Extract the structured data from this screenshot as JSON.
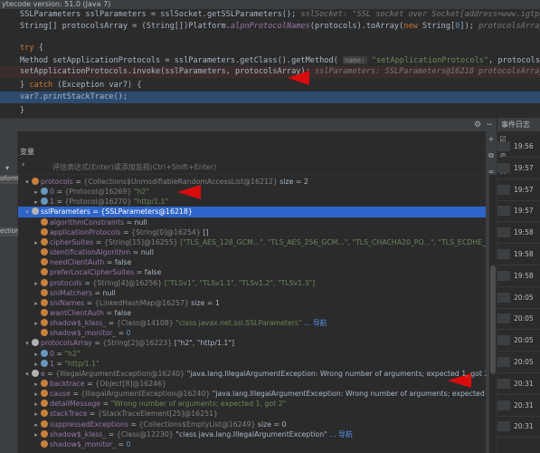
{
  "banner": {
    "text": "ytecode version: 51.0 (Java 7)"
  },
  "editor": {
    "lines": [
      {
        "parts": [
          [
            "",
            "SSLParameters sslParameters = sslSocket.getSSLParameters();"
          ],
          [
            "hint",
            "  sslSocket: \"SSL socket over Socket[address=www.igtpgtng.com/52.77.193.19,port=443,loc\""
          ]
        ]
      },
      {
        "parts": [
          [
            "",
            "String[] protocolsArray = (String[])Platform."
          ],
          [
            "fn",
            "alpnProtocolNames"
          ],
          [
            "",
            "(protocols).toArray("
          ],
          [
            "kw",
            "new "
          ],
          [
            "",
            "String["
          ],
          [
            "num",
            "0"
          ],
          [
            "",
            "]);"
          ],
          [
            "hint",
            "  protocolsArray: [\"h2\", \"http/1.1\"]"
          ]
        ]
      },
      {
        "parts": [
          [
            "",
            ""
          ]
        ]
      },
      {
        "parts": [
          [
            "kw",
            "try "
          ],
          [
            "",
            "{"
          ]
        ]
      },
      {
        "parts": [
          [
            "",
            "    Method setApplicationProtocols = sslParameters.getClass().getMethod( "
          ],
          [
            "box",
            "name:"
          ],
          [
            "str",
            " \"setApplicationProtocols\""
          ],
          [
            "",
            ", protocolsArray.getClass());"
          ]
        ]
      },
      {
        "parts": [
          [
            "",
            "    setApplicationProtocols.invoke(sslParameters, protocolsArray);"
          ],
          [
            "hint",
            "   sslParameters: SSLParameters@16218    protocolsArray: [\"h2\", \"h"
          ]
        ]
      },
      {
        "parts": [
          [
            "",
            "} "
          ],
          [
            "kw",
            "catch "
          ],
          [
            "",
            "(Exception var7) {"
          ]
        ]
      },
      {
        "parts": [
          [
            "",
            "    var7.printStackTrace();"
          ]
        ]
      },
      {
        "parts": [
          [
            "",
            "}"
          ]
        ]
      }
    ]
  },
  "debugger": {
    "frames_title": "变量",
    "frame_tags": [
      "oform)",
      "ection"
    ],
    "expression": {
      "placeholder": "评估表达式(Enter)或添加监视(Ctrl+Shift+Enter)"
    },
    "variables": [
      {
        "indent": 0,
        "toggle": "▾",
        "icon": "f",
        "name": "protocols",
        "type": "{Collections$UnmodifiableRandomAccessList@16212}",
        "value": "size = 2",
        "vclass": "plain"
      },
      {
        "indent": 1,
        "toggle": "▸",
        "icon": "n",
        "name": "0",
        "type": "{Protocol@16269}",
        "value": "\"h2\"",
        "vclass": "str"
      },
      {
        "indent": 1,
        "toggle": "▸",
        "icon": "n",
        "name": "1",
        "type": "{Protocol@16270}",
        "value": "\"http/1.1\"",
        "vclass": "str"
      },
      {
        "indent": 0,
        "toggle": "▾",
        "icon": "p",
        "name": "sslParameters",
        "type": "{SSLParameters@16218}",
        "value": "",
        "vclass": "plain",
        "selected": true
      },
      {
        "indent": 1,
        "toggle": "",
        "icon": "f",
        "name": "algorithmConstraints",
        "type": "",
        "value": "null",
        "vclass": "plain"
      },
      {
        "indent": 1,
        "toggle": "",
        "icon": "f",
        "name": "applicationProtocols",
        "type": "{String[0]@16254}",
        "value": "[]",
        "vclass": "plain"
      },
      {
        "indent": 1,
        "toggle": "▸",
        "icon": "f",
        "name": "cipherSuites",
        "type": "{String[15]@16255}",
        "value": "[\"TLS_AES_128_GCM...\", \"TLS_AES_256_GCM...\", \"TLS_CHACHA20_PO...\", \"TLS_ECDHE_ECDSA...\", \"TLS_ECDHE_ECDSA...\", \"TL",
        "vclass": "str"
      },
      {
        "indent": 1,
        "toggle": "",
        "icon": "f",
        "name": "identificationAlgorithm",
        "type": "",
        "value": "null",
        "vclass": "plain"
      },
      {
        "indent": 1,
        "toggle": "",
        "icon": "f",
        "name": "needClientAuth",
        "type": "",
        "value": "false",
        "vclass": "plain"
      },
      {
        "indent": 1,
        "toggle": "",
        "icon": "f",
        "name": "preferLocalCipherSuites",
        "type": "",
        "value": "false",
        "vclass": "plain"
      },
      {
        "indent": 1,
        "toggle": "▸",
        "icon": "f",
        "name": "protocols",
        "type": "{String[4]@16256}",
        "value": "[\"TLSv1\", \"TLSv1.1\", \"TLSv1.2\", \"TLSv1.3\"]",
        "vclass": "str"
      },
      {
        "indent": 1,
        "toggle": "",
        "icon": "f",
        "name": "sniMatchers",
        "type": "",
        "value": "null",
        "vclass": "plain"
      },
      {
        "indent": 1,
        "toggle": "▸",
        "icon": "f",
        "name": "sniNames",
        "type": "{LinkedHashMap@16257}",
        "value": "size = 1",
        "vclass": "plain"
      },
      {
        "indent": 1,
        "toggle": "",
        "icon": "f",
        "name": "wantClientAuth",
        "type": "",
        "value": "false",
        "vclass": "plain"
      },
      {
        "indent": 1,
        "toggle": "▸",
        "icon": "f",
        "name": "shadow$_klass_",
        "type": "{Class@14108}",
        "value": "\"class javax.net.ssl.SSLParameters\"",
        "vclass": "str",
        "link": "... 导航"
      },
      {
        "indent": 1,
        "toggle": "",
        "icon": "f",
        "name": "shadow$_monitor_",
        "type": "",
        "value": "0",
        "vclass": "num"
      },
      {
        "indent": 0,
        "toggle": "▾",
        "icon": "p",
        "name": "protocolsArray",
        "type": "{String[2]@16223}",
        "value": "[\"h2\", \"http/1.1\"]",
        "vclass": "plain"
      },
      {
        "indent": 1,
        "toggle": "▸",
        "icon": "n",
        "name": "0",
        "type": "",
        "value": "\"h2\"",
        "vclass": "str"
      },
      {
        "indent": 1,
        "toggle": "▸",
        "icon": "n",
        "name": "1",
        "type": "",
        "value": "\"http/1.1\"",
        "vclass": "str"
      },
      {
        "indent": 0,
        "toggle": "▾",
        "icon": "p",
        "name": "e",
        "type": "{IllegalArgumentException@16240}",
        "value": "\"java.lang.IllegalArgumentException: Wrong number of arguments; expected 1, got 2\"",
        "vclass": "plain"
      },
      {
        "indent": 1,
        "toggle": "▸",
        "icon": "f",
        "name": "backtrace",
        "type": "{Object[8]@16246}",
        "value": "",
        "vclass": "plain"
      },
      {
        "indent": 1,
        "toggle": "▸",
        "icon": "f",
        "name": "cause",
        "type": "{IllegalArgumentException@16240}",
        "value": "\"java.lang.IllegalArgumentException: Wrong number of arguments; expected 1, got 2\"",
        "vclass": "plain"
      },
      {
        "indent": 1,
        "toggle": "▸",
        "icon": "f",
        "name": "detailMessage",
        "type": "",
        "value": "\"Wrong number of arguments; expected 1, got 2\"",
        "vclass": "str"
      },
      {
        "indent": 1,
        "toggle": "▸",
        "icon": "f",
        "name": "stackTrace",
        "type": "{StackTraceElement[25]@16251}",
        "value": "",
        "vclass": "plain"
      },
      {
        "indent": 1,
        "toggle": "▸",
        "icon": "f",
        "name": "suppressedExceptions",
        "type": "{Collections$EmptyList@16249}",
        "value": "size = 0",
        "vclass": "plain"
      },
      {
        "indent": 1,
        "toggle": "▸",
        "icon": "f",
        "name": "shadow$_klass_",
        "type": "{Class@12230}",
        "value": "\"class java.lang.IllegalArgumentException\"",
        "vclass": "plain",
        "link": "... 导航"
      },
      {
        "indent": 1,
        "toggle": "",
        "icon": "f",
        "name": "shadow$_monitor_",
        "type": "",
        "value": "0",
        "vclass": "num"
      }
    ]
  },
  "event_log": {
    "title": "事件日志",
    "times": [
      "19:56",
      "19:57",
      "19:57",
      "19:57",
      "19:58",
      "19:58",
      "19:58",
      "20:05",
      "20:05",
      "20:05",
      "20:05",
      "20:31",
      "20:31",
      "20:31"
    ]
  },
  "colors": {
    "selection": "#2f65ca",
    "annotation_arrow": "#d80c0c",
    "background": "#2b2b2b"
  }
}
